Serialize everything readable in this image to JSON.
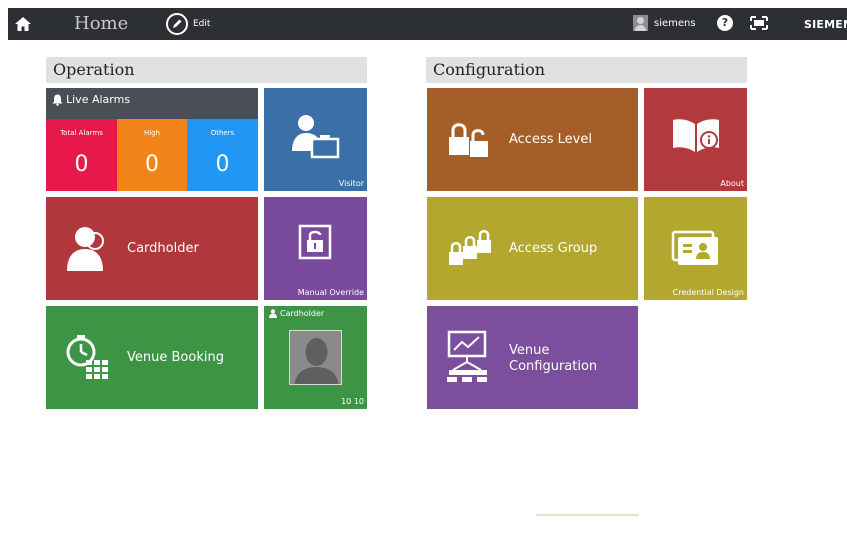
{
  "topbar": {
    "home_title": "Home",
    "edit_label": "Edit",
    "user_name": "siemens",
    "help_label": "?",
    "brand": "SIEMENS",
    "icons": [
      "home-icon",
      "edit-pencil-icon",
      "user-avatar-icon",
      "help-icon",
      "fullscreen-icon"
    ]
  },
  "operation": {
    "title": "Operation",
    "live_alarms": {
      "title": "Live Alarms",
      "total": {
        "label": "Total Alarms",
        "value": "0",
        "color": "#e8194a"
      },
      "high": {
        "label": "High",
        "value": "0",
        "color": "#f28319"
      },
      "others": {
        "label": "Others",
        "value": "0",
        "color": "#2196f2"
      }
    },
    "visitor": {
      "label": "Visitor",
      "color": "#3b6fa8"
    },
    "cardholder": {
      "label": "Cardholder",
      "color": "#b0383d"
    },
    "manual_override": {
      "label": "Manual Override",
      "color": "#7a4a9c"
    },
    "venue_booking": {
      "label": "Venue Booking",
      "color": "#3e9445"
    },
    "cardholder_photo": {
      "title": "Cardholder",
      "caption": "10 10",
      "color": "#3e9445"
    }
  },
  "configuration": {
    "title": "Configuration",
    "access_level": {
      "label": "Access Level",
      "color": "#a55e28"
    },
    "about": {
      "label": "About",
      "color": "#b23a3f"
    },
    "access_group": {
      "label": "Access Group",
      "color": "#b3a730"
    },
    "credential_design": {
      "label": "Credential Design",
      "color": "#b3a730"
    },
    "venue_configuration": {
      "label_line1": "Venue",
      "label_line2": "Configuration",
      "color": "#7c4e9e"
    }
  }
}
